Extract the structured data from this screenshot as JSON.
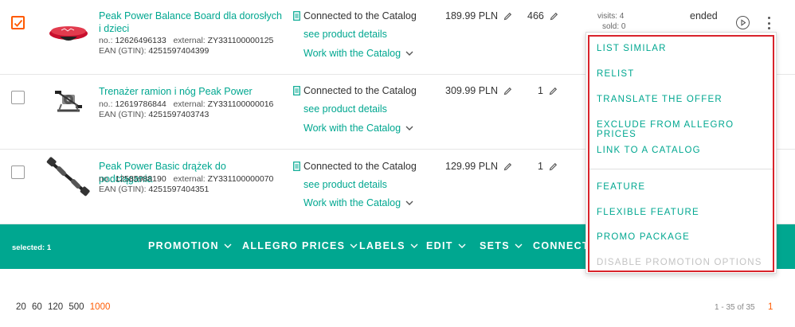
{
  "rows": [
    {
      "checked": true,
      "name": "Peak Power Balance Board dla dorosłych i dzieci",
      "no_label": "no.:",
      "no": "12626496133",
      "external_label": "external:",
      "external": "ZY331100000125",
      "ean_label": "EAN (GTIN):",
      "ean": "4251597404399",
      "catalog_status": "Connected to the Catalog",
      "catalog_link": "see product details",
      "catalog_work": "Work with the Catalog",
      "price": "189.99 PLN",
      "qty": "466",
      "visits": "visits: 4",
      "sold": "sold: 0",
      "status": "ended"
    },
    {
      "checked": false,
      "name": "Trenażer ramion i nóg Peak Power",
      "no_label": "no.:",
      "no": "12619786844",
      "external_label": "external:",
      "external": "ZY331100000016",
      "ean_label": "EAN (GTIN):",
      "ean": "4251597403743",
      "catalog_status": "Connected to the Catalog",
      "catalog_link": "see product details",
      "catalog_work": "Work with the Catalog",
      "price": "309.99 PLN",
      "qty": "1"
    },
    {
      "checked": false,
      "name": "Peak Power Basic drążek do podciągania",
      "no_label": "no.:",
      "no": "12585988190",
      "external_label": "external:",
      "external": "ZY331100000070",
      "ean_label": "EAN (GTIN):",
      "ean": "4251597404351",
      "catalog_status": "Connected to the Catalog",
      "catalog_link": "see product details",
      "catalog_work": "Work with the Catalog",
      "price": "129.99 PLN",
      "qty": "1"
    }
  ],
  "action_bar": {
    "selected": "selected: 1",
    "actions": [
      "PROMOTION",
      "ALLEGRO PRICES",
      "LABELS",
      "EDIT",
      "SETS",
      "CONNECT"
    ]
  },
  "dropdown_menu": {
    "group1": [
      "LIST SIMILAR",
      "RELIST",
      "TRANSLATE THE OFFER",
      "EXCLUDE FROM ALLEGRO PRICES",
      "LINK TO A CATALOG"
    ],
    "group2": [
      "FEATURE",
      "FLEXIBLE FEATURE",
      "PROMO PACKAGE"
    ],
    "disabled_item": "DISABLE PROMOTION OPTIONS"
  },
  "pagination": {
    "page_sizes": [
      "20",
      "60",
      "120",
      "500",
      "1000"
    ],
    "active_page_size": "1000",
    "range": "1 - 35 of 35",
    "current_page": "1"
  },
  "colors": {
    "accent": "#00a790",
    "orange": "#ff5a00",
    "highlight": "#d9232b"
  },
  "icons": {
    "checkbox_checked": "checkmark-icon",
    "catalog": "document-icon",
    "edit": "pencil-icon",
    "expand": "chevron-down-icon",
    "activate": "play-circle-icon",
    "more": "kebab-icon"
  }
}
